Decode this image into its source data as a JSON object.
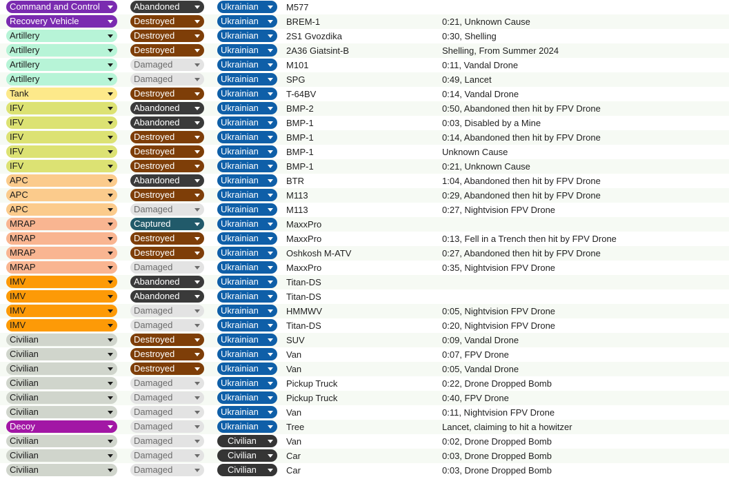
{
  "colors": {
    "row_alt": "#f6faf4",
    "type": {
      "Command and Control": "#7a2bb0",
      "Recovery Vehicle": "#7a2bb0",
      "Artillery": "#b7f4d7",
      "Tank": "#fde98a",
      "IFV": "#dce273",
      "APC": "#fbcb8c",
      "MRAP": "#f9b591",
      "IMV": "#fd9a07",
      "Civilian": "#d0d5cc",
      "Decoy": "#a217a5"
    },
    "status": {
      "Abandoned": "#3a3a3a",
      "Destroyed": "#7e3e08",
      "Damaged": "#e3e3e3",
      "Captured": "#215a6a"
    },
    "side": {
      "Ukrainian": "#0f5fa8",
      "Civilian": "#353535"
    }
  },
  "icons": {
    "dropdown": "chevron-down-icon"
  },
  "rows": [
    {
      "type": "Command and Control",
      "status": "Abandoned",
      "side": "Ukrainian",
      "model": "M577",
      "note": ""
    },
    {
      "type": "Recovery Vehicle",
      "status": "Destroyed",
      "side": "Ukrainian",
      "model": "BREM-1",
      "note": "0:21, Unknown Cause"
    },
    {
      "type": "Artillery",
      "status": "Destroyed",
      "side": "Ukrainian",
      "model": "2S1 Gvozdika",
      "note": "0:30, Shelling"
    },
    {
      "type": "Artillery",
      "status": "Destroyed",
      "side": "Ukrainian",
      "model": "2A36 Giatsint-B",
      "note": "Shelling, From Summer 2024"
    },
    {
      "type": "Artillery",
      "status": "Damaged",
      "side": "Ukrainian",
      "model": "M101",
      "note": "0:11, Vandal Drone"
    },
    {
      "type": "Artillery",
      "status": "Damaged",
      "side": "Ukrainian",
      "model": "SPG",
      "note": "0:49, Lancet"
    },
    {
      "type": "Tank",
      "status": "Destroyed",
      "side": "Ukrainian",
      "model": "T-64BV",
      "note": "0:14, Vandal Drone"
    },
    {
      "type": "IFV",
      "status": "Abandoned",
      "side": "Ukrainian",
      "model": "BMP-2",
      "note": "0:50, Abandoned then hit by FPV Drone"
    },
    {
      "type": "IFV",
      "status": "Abandoned",
      "side": "Ukrainian",
      "model": "BMP-1",
      "note": "0:03, Disabled by a Mine"
    },
    {
      "type": "IFV",
      "status": "Destroyed",
      "side": "Ukrainian",
      "model": "BMP-1",
      "note": "0:14, Abandoned then hit by FPV Drone"
    },
    {
      "type": "IFV",
      "status": "Destroyed",
      "side": "Ukrainian",
      "model": "BMP-1",
      "note": "Unknown Cause"
    },
    {
      "type": "IFV",
      "status": "Destroyed",
      "side": "Ukrainian",
      "model": "BMP-1",
      "note": "0:21, Unknown Cause"
    },
    {
      "type": "APC",
      "status": "Abandoned",
      "side": "Ukrainian",
      "model": "BTR",
      "note": "1:04, Abandoned then hit by FPV Drone"
    },
    {
      "type": "APC",
      "status": "Destroyed",
      "side": "Ukrainian",
      "model": "M113",
      "note": "0:29, Abandoned then hit by FPV Drone"
    },
    {
      "type": "APC",
      "status": "Damaged",
      "side": "Ukrainian",
      "model": "M113",
      "note": "0:27, Nightvision FPV Drone"
    },
    {
      "type": "MRAP",
      "status": "Captured",
      "side": "Ukrainian",
      "model": "MaxxPro",
      "note": ""
    },
    {
      "type": "MRAP",
      "status": "Destroyed",
      "side": "Ukrainian",
      "model": "MaxxPro",
      "note": "0:13, Fell in a Trench then hit by FPV Drone"
    },
    {
      "type": "MRAP",
      "status": "Destroyed",
      "side": "Ukrainian",
      "model": "Oshkosh M-ATV",
      "note": "0:27, Abandoned then hit by FPV Drone"
    },
    {
      "type": "MRAP",
      "status": "Damaged",
      "side": "Ukrainian",
      "model": "MaxxPro",
      "note": "0:35, Nightvision FPV Drone"
    },
    {
      "type": "IMV",
      "status": "Abandoned",
      "side": "Ukrainian",
      "model": "Titan-DS",
      "note": ""
    },
    {
      "type": "IMV",
      "status": "Abandoned",
      "side": "Ukrainian",
      "model": "Titan-DS",
      "note": ""
    },
    {
      "type": "IMV",
      "status": "Damaged",
      "side": "Ukrainian",
      "model": "HMMWV",
      "note": "0:05, Nightvision FPV Drone"
    },
    {
      "type": "IMV",
      "status": "Damaged",
      "side": "Ukrainian",
      "model": "Titan-DS",
      "note": "0:20, Nightvision FPV Drone"
    },
    {
      "type": "Civilian",
      "status": "Destroyed",
      "side": "Ukrainian",
      "model": "SUV",
      "note": "0:09, Vandal Drone"
    },
    {
      "type": "Civilian",
      "status": "Destroyed",
      "side": "Ukrainian",
      "model": "Van",
      "note": "0:07, FPV Drone"
    },
    {
      "type": "Civilian",
      "status": "Destroyed",
      "side": "Ukrainian",
      "model": "Van",
      "note": "0:05, Vandal Drone"
    },
    {
      "type": "Civilian",
      "status": "Damaged",
      "side": "Ukrainian",
      "model": "Pickup Truck",
      "note": "0:22, Drone Dropped Bomb"
    },
    {
      "type": "Civilian",
      "status": "Damaged",
      "side": "Ukrainian",
      "model": "Pickup Truck",
      "note": "0:40, FPV Drone"
    },
    {
      "type": "Civilian",
      "status": "Damaged",
      "side": "Ukrainian",
      "model": "Van",
      "note": "0:11, Nightvision FPV Drone"
    },
    {
      "type": "Decoy",
      "status": "Damaged",
      "side": "Ukrainian",
      "model": "Tree",
      "note": "Lancet, claiming to hit a howitzer"
    },
    {
      "type": "Civilian",
      "status": "Damaged",
      "side": "Civilian",
      "model": "Van",
      "note": "0:02, Drone Dropped Bomb"
    },
    {
      "type": "Civilian",
      "status": "Damaged",
      "side": "Civilian",
      "model": "Car",
      "note": "0:03, Drone Dropped Bomb"
    },
    {
      "type": "Civilian",
      "status": "Damaged",
      "side": "Civilian",
      "model": "Car",
      "note": "0:03, Drone Dropped Bomb"
    }
  ]
}
